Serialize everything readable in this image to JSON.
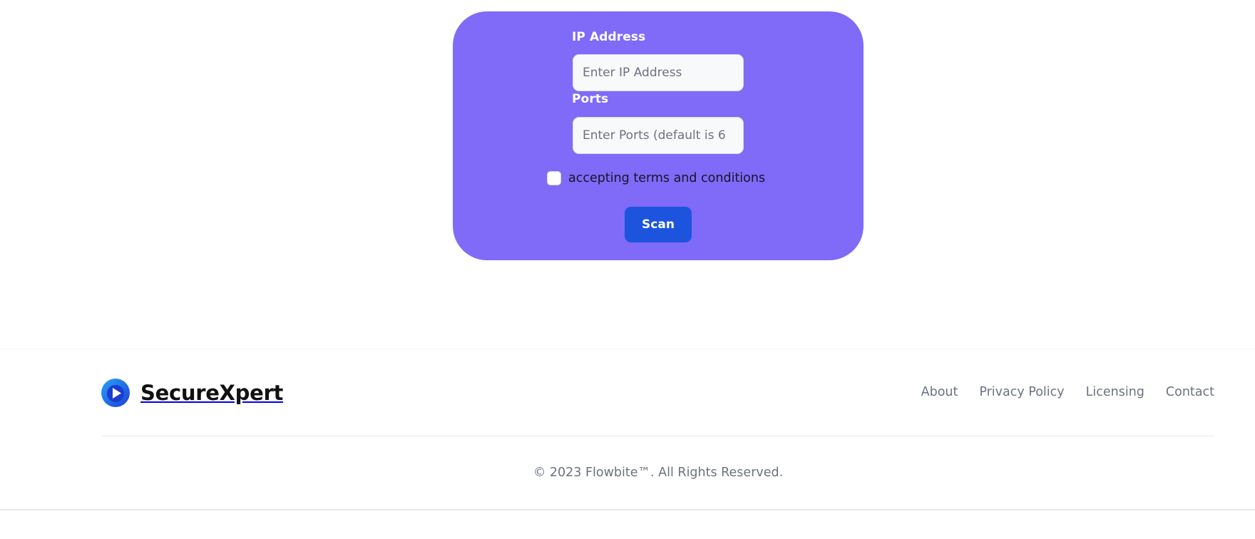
{
  "scan_form": {
    "ip_label": "IP Address",
    "ip_placeholder": "Enter IP Address",
    "ip_value": "",
    "ports_label": "Ports",
    "ports_placeholder": "Enter Ports (default is 6",
    "ports_value": "",
    "terms_label": "accepting terms and conditions",
    "terms_checked": false,
    "scan_label": "Scan",
    "card_color": "#806af8",
    "button_color": "#1c54de"
  },
  "footer": {
    "brand_name": "SecureXpert",
    "logo_icon": "play-circle-logo-icon",
    "links": [
      {
        "label": "About"
      },
      {
        "label": "Privacy Policy"
      },
      {
        "label": "Licensing"
      },
      {
        "label": "Contact"
      }
    ],
    "copyright": "© 2023 Flowbite™. All Rights Reserved."
  }
}
